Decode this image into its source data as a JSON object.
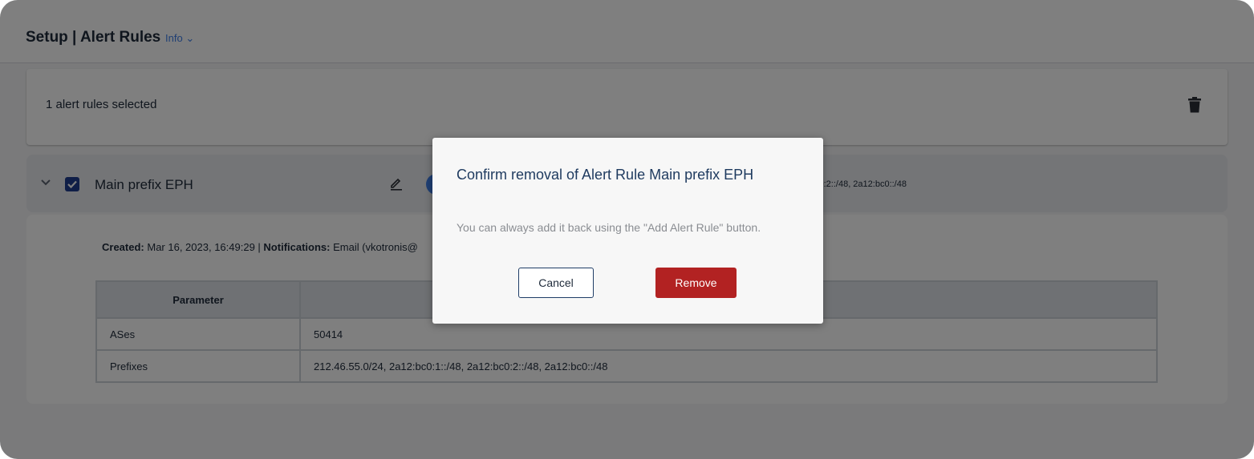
{
  "header": {
    "title": "Setup | Alert Rules",
    "info_label": "Info",
    "info_chevron": "⌄"
  },
  "selection_bar": {
    "text": "1 alert rules selected",
    "delete_icon": "trash-icon"
  },
  "rule": {
    "name": "Main prefix EPH",
    "checked": true,
    "row_prefixes_partial": "c0:2::/48, 2a12:bc0::/48",
    "created_label": "Created:",
    "created_value": "Mar 16, 2023, 16:49:29 |",
    "notifications_label": "Notifications:",
    "notifications_value": "Email (vkotronis@"
  },
  "params_table": {
    "header": "Parameter",
    "rows": [
      {
        "name": "ASes",
        "value": "50414"
      },
      {
        "name": "Prefixes",
        "value": "212.46.55.0/24, 2a12:bc0:1::/48, 2a12:bc0:2::/48, 2a12:bc0::/48"
      }
    ]
  },
  "modal": {
    "title": "Confirm removal of Alert Rule Main prefix EPH",
    "body": "You can always add it back using the \"Add Alert Rule\" button.",
    "cancel_label": "Cancel",
    "remove_label": "Remove"
  },
  "colors": {
    "accent": "#3f7ee8",
    "checkbox": "#1f3d8f",
    "danger": "#b22222"
  }
}
